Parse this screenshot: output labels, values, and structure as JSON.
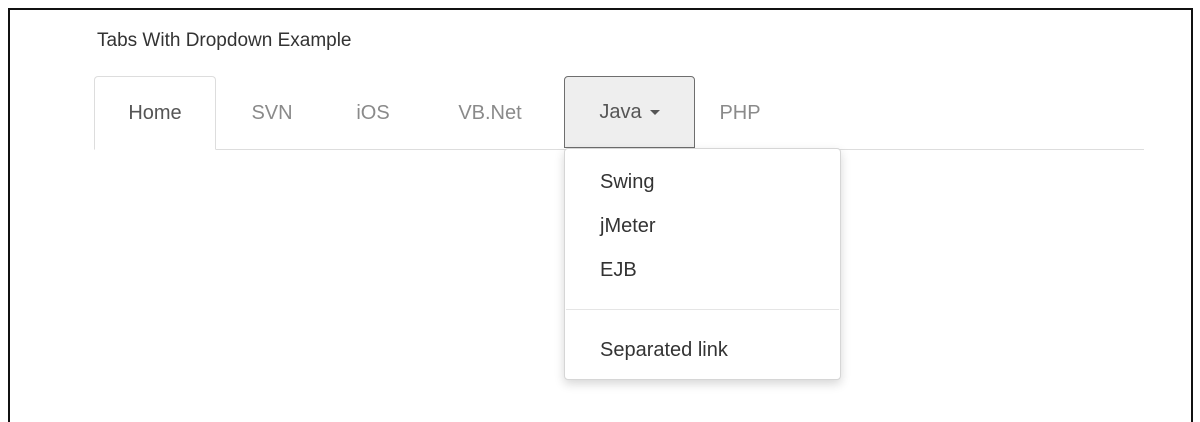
{
  "heading": "Tabs With Dropdown Example",
  "tabs": [
    {
      "label": "Home",
      "active": true
    },
    {
      "label": "SVN"
    },
    {
      "label": "iOS"
    },
    {
      "label": "VB.Net"
    },
    {
      "label": "Java",
      "has_dropdown": true,
      "open": true
    },
    {
      "label": "PHP"
    }
  ],
  "dropdown": {
    "items": [
      {
        "label": "Swing"
      },
      {
        "label": "jMeter"
      },
      {
        "label": "EJB"
      }
    ],
    "separated_item": {
      "label": "Separated link"
    }
  },
  "icons": {
    "java_caret": "caret-down-icon"
  },
  "colors": {
    "text": "#333333",
    "muted_tab_text": "#8a8a8a",
    "active_tab_text": "#555555",
    "border": "#dddddd",
    "open_tab_bg": "#eeeeee"
  }
}
